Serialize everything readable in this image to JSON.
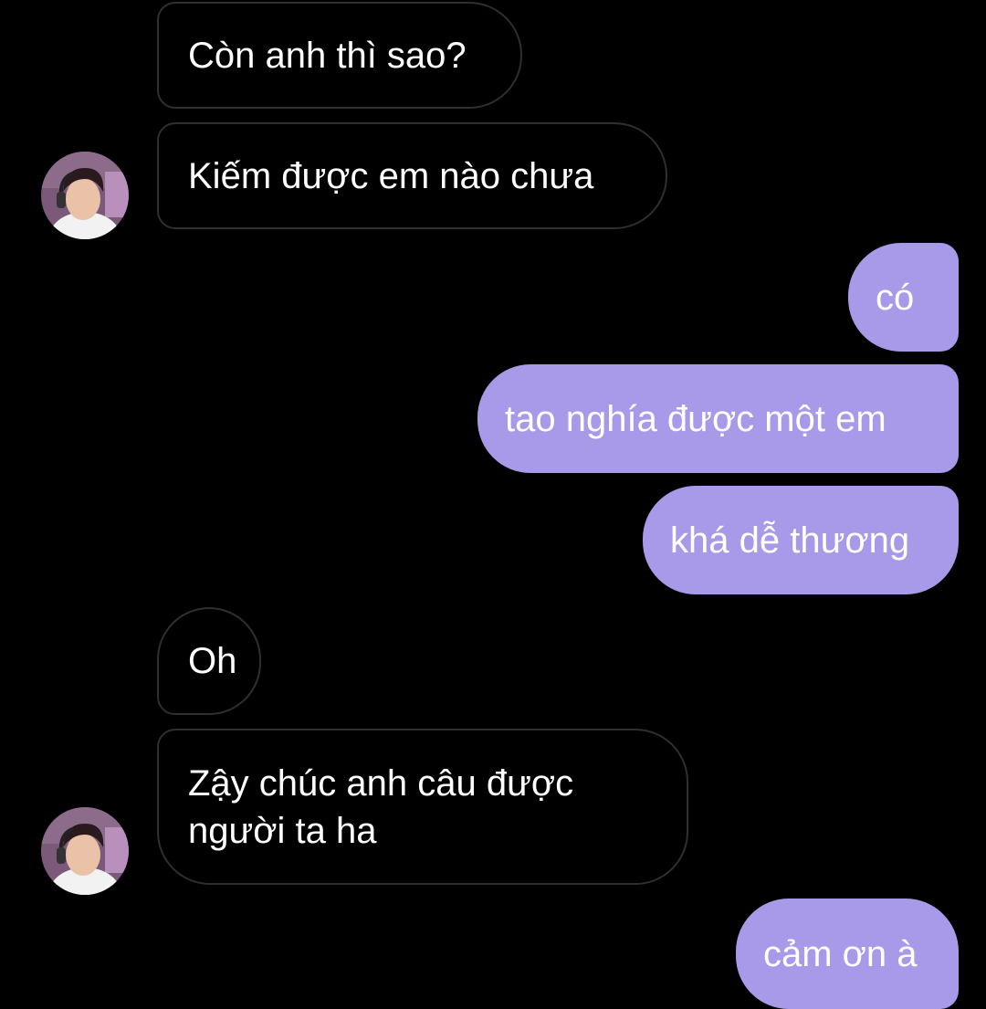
{
  "conversation": {
    "messages": [
      {
        "from": "them",
        "text": "Còn anh thì sao?"
      },
      {
        "from": "them",
        "text": "Kiếm được em nào chưa"
      },
      {
        "from": "me",
        "text": "có"
      },
      {
        "from": "me",
        "text": "tao nghía được một em"
      },
      {
        "from": "me",
        "text": "khá dễ thương"
      },
      {
        "from": "them",
        "text": "Oh"
      },
      {
        "from": "them",
        "text_line1": "Zậy chúc anh câu được",
        "text_line2": "người ta ha"
      },
      {
        "from": "me",
        "text": "cảm ơn à"
      }
    ]
  },
  "colors": {
    "background": "#000000",
    "outgoing_bubble": "#a89ae8",
    "incoming_bubble_border": "#2f2f2f",
    "text": "#ffffff"
  },
  "icons": {
    "avatar": "contact-avatar-photo"
  }
}
